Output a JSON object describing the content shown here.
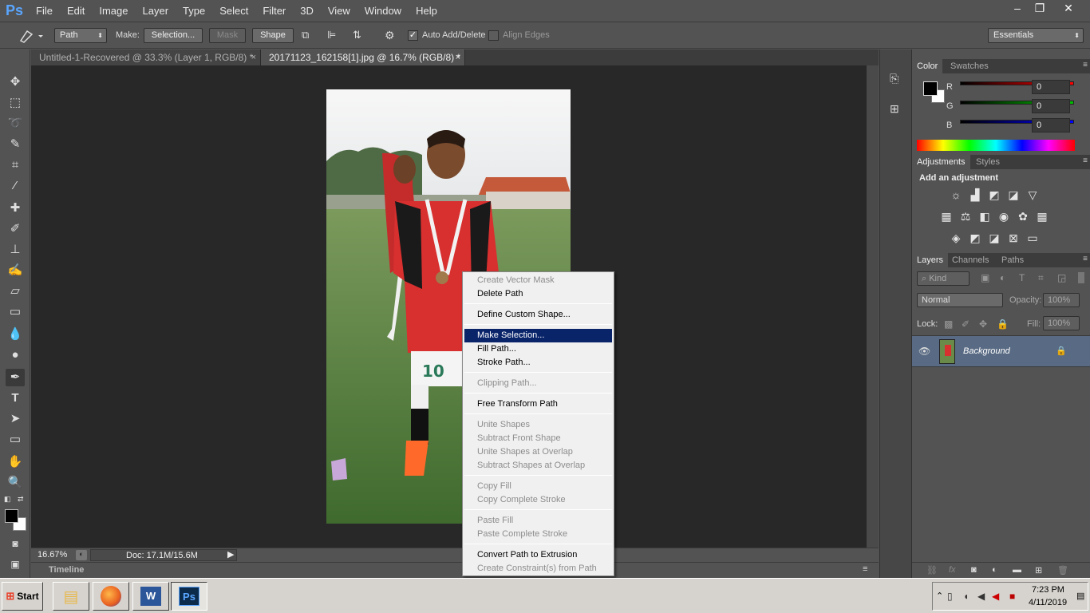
{
  "app": {
    "logo": "Ps"
  },
  "menu": [
    "File",
    "Edit",
    "Image",
    "Layer",
    "Type",
    "Select",
    "Filter",
    "3D",
    "View",
    "Window",
    "Help"
  ],
  "window_controls": {
    "minimize": "–",
    "restore": "❐",
    "close": "✕"
  },
  "options": {
    "mode_value": "Path",
    "make_label": "Make:",
    "selection_btn": "Selection...",
    "mask_btn": "Mask",
    "shape_btn": "Shape",
    "auto_add_delete": "Auto Add/Delete",
    "align_edges": "Align Edges",
    "workspace": "Essentials"
  },
  "tabs": [
    {
      "label": "Untitled-1-Recovered @ 33.3% (Layer 1, RGB/8) *",
      "close": "×"
    },
    {
      "label": "20171123_162158[1].jpg @ 16.7% (RGB/8) *",
      "close": "×"
    }
  ],
  "status": {
    "zoom": "16.67%",
    "doc": "Doc: 17.1M/15.6M"
  },
  "timeline": {
    "label": "Timeline"
  },
  "context_menu": {
    "items": [
      {
        "label": "Create Vector Mask",
        "state": "disabled"
      },
      {
        "label": "Delete Path",
        "state": "enabled"
      },
      {
        "label": "Define Custom Shape...",
        "state": "enabled"
      },
      {
        "label": "Make Selection...",
        "state": "selected"
      },
      {
        "label": "Fill Path...",
        "state": "enabled"
      },
      {
        "label": "Stroke Path...",
        "state": "enabled"
      },
      {
        "label": "Clipping Path...",
        "state": "disabled"
      },
      {
        "label": "Free Transform Path",
        "state": "enabled"
      },
      {
        "label": "Unite Shapes",
        "state": "disabled"
      },
      {
        "label": "Subtract Front Shape",
        "state": "disabled"
      },
      {
        "label": "Unite Shapes at Overlap",
        "state": "disabled"
      },
      {
        "label": "Subtract Shapes at Overlap",
        "state": "disabled"
      },
      {
        "label": "Copy Fill",
        "state": "disabled"
      },
      {
        "label": "Copy Complete Stroke",
        "state": "disabled"
      },
      {
        "label": "Paste Fill",
        "state": "disabled"
      },
      {
        "label": "Paste Complete Stroke",
        "state": "disabled"
      },
      {
        "label": "Convert Path to Extrusion",
        "state": "enabled"
      },
      {
        "label": "Create Constraint(s) from Path",
        "state": "disabled"
      }
    ]
  },
  "color_panel": {
    "tabs": [
      "Color",
      "Swatches"
    ],
    "channels": [
      {
        "label": "R",
        "value": "0",
        "color": "#ff0000"
      },
      {
        "label": "G",
        "value": "0",
        "color": "#00c000"
      },
      {
        "label": "B",
        "value": "0",
        "color": "#0000ff"
      }
    ]
  },
  "adjustments_panel": {
    "tabs": [
      "Adjustments",
      "Styles"
    ],
    "title": "Add an adjustment"
  },
  "layers_panel": {
    "tabs": [
      "Layers",
      "Channels",
      "Paths"
    ],
    "filter_kind": "Kind",
    "blend_mode": "Normal",
    "opacity_label": "Opacity:",
    "opacity_value": "100%",
    "lock_label": "Lock:",
    "fill_label": "Fill:",
    "fill_value": "100%",
    "layers": [
      {
        "name": "Background"
      }
    ]
  },
  "taskbar": {
    "start": "Start",
    "time": "7:23 PM",
    "date": "4/11/2019"
  }
}
